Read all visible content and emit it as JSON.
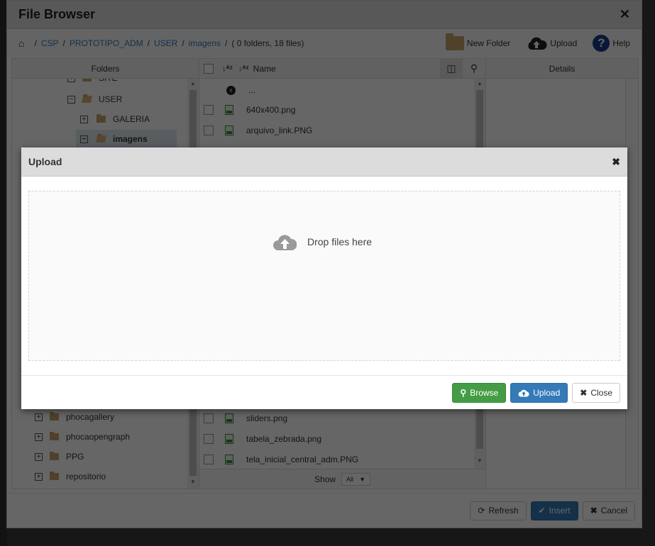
{
  "file_browser": {
    "title": "File Browser",
    "breadcrumb": {
      "items": [
        "CSP",
        "PROTOTIPO_ADM",
        "USER",
        "imagens"
      ],
      "summary": "( 0 folders, 18 files)"
    },
    "toolbar": {
      "new_folder_label": "New Folder",
      "upload_label": "Upload",
      "help_label": "Help"
    },
    "panels": {
      "folders_title": "Folders",
      "name_column": "Name",
      "details_title": "Details"
    },
    "folder_tree": [
      {
        "label": "SITE",
        "state": "collapsed",
        "level": 1
      },
      {
        "label": "USER",
        "state": "expanded",
        "level": 1
      },
      {
        "label": "GALERIA",
        "state": "collapsed",
        "level": 2
      },
      {
        "label": "imagens",
        "state": "expanded",
        "level": 2,
        "selected": true
      },
      {
        "label": "phocagallery",
        "state": "collapsed",
        "level": 0
      },
      {
        "label": "phocaopengraph",
        "state": "collapsed",
        "level": 0
      },
      {
        "label": "PPG",
        "state": "collapsed",
        "level": 0
      },
      {
        "label": "repositorio",
        "state": "collapsed",
        "level": 0
      }
    ],
    "files_top": [
      {
        "name": "...",
        "type": "parent"
      },
      {
        "name": "640x400.png",
        "type": "image"
      },
      {
        "name": "arquivo_link.PNG",
        "type": "image"
      }
    ],
    "files_bottom": [
      {
        "name": "sliders.png",
        "type": "image"
      },
      {
        "name": "tabela_zebrada.png",
        "type": "image"
      },
      {
        "name": "tela_inicial_central_adm.PNG",
        "type": "image"
      }
    ],
    "pager": {
      "show_label": "Show",
      "selected": "All"
    },
    "footer": {
      "refresh_label": "Refresh",
      "insert_label": "Insert",
      "cancel_label": "Cancel"
    }
  },
  "upload_modal": {
    "title": "Upload",
    "dropzone_text": "Drop files here",
    "browse_label": "Browse",
    "upload_label": "Upload",
    "close_label": "Close"
  },
  "colors": {
    "primary": "#337ab7",
    "success": "#449d44",
    "folder": "#c9a46a",
    "help": "#1a3a8a"
  }
}
